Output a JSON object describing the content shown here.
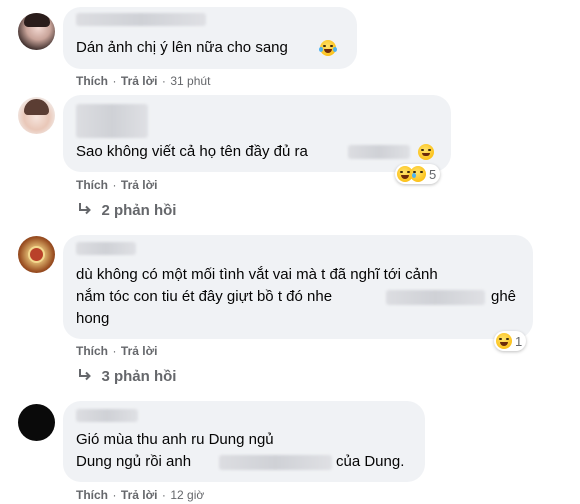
{
  "comments": [
    {
      "text_lines": [
        "Dán ảnh chị ý lên nữa cho sang"
      ],
      "actions": {
        "like": "Thích",
        "reply": "Trả lời",
        "time": "31 phút"
      }
    },
    {
      "text_lines": [
        "Sao không viết cả họ tên đầy đủ ra"
      ],
      "actions": {
        "like": "Thích",
        "reply": "Trả lời"
      },
      "reaction_count": "5",
      "replies_label": "2 phản hồi"
    },
    {
      "text_lines": [
        "dù không có một mối tình vắt vai mà t đã nghĩ tới cảnh",
        "nắm tóc con tiu ét đây giựt bồ t đó nhe",
        "ghê",
        "hong"
      ],
      "actions": {
        "like": "Thích",
        "reply": "Trả lời"
      },
      "reaction_count": "1",
      "replies_label": "3 phản hồi"
    },
    {
      "text_lines": [
        "Gió mùa thu anh ru Dung ngủ",
        "Dung ngủ rồi anh",
        "của Dung."
      ],
      "actions": {
        "like": "Thích",
        "reply": "Trả lời",
        "time": "12 giờ"
      }
    }
  ],
  "separator": "·",
  "colors": {
    "bubble": "#f0f2f5",
    "secondary_text": "#65676b",
    "primary_text": "#050505"
  },
  "icons": [
    "reply-arrow-icon",
    "laugh-emoji-icon",
    "sad-emoji-icon"
  ]
}
